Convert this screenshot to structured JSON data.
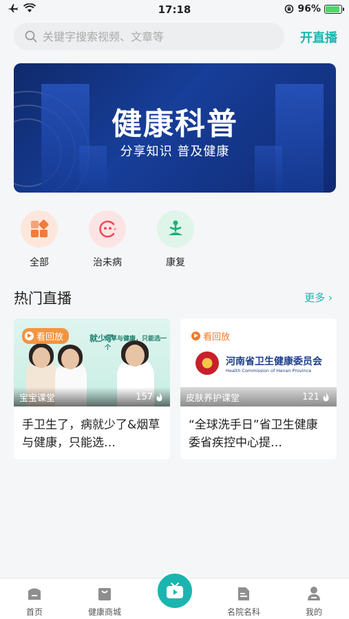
{
  "status_bar": {
    "time": "17:18",
    "battery": "96%",
    "battery_level": 0.96
  },
  "search": {
    "placeholder": "关键字搜索视频、文章等",
    "go_live_label": "开直播"
  },
  "banner": {
    "title": "健康科普",
    "subtitle": "分享知识 普及健康"
  },
  "categories": [
    {
      "label": "全部",
      "icon": "grid-icon",
      "bg": "#fde7dc",
      "color": "#f27b3c"
    },
    {
      "label": "治未病",
      "icon": "smile-icon",
      "bg": "#fde4e4",
      "color": "#ea4c5a"
    },
    {
      "label": "康复",
      "icon": "meditation-icon",
      "bg": "#dff5ea",
      "color": "#1fb07a"
    }
  ],
  "section": {
    "title": "热门直播",
    "more_label": "更多 ›"
  },
  "cards": [
    {
      "badge": "看回放",
      "channel": "宝宝课堂",
      "views": "157",
      "title": "手卫生了，病就少了&烟草与健康，只能选…",
      "thumb_text_1": "就少了",
      "thumb_text_2": "烟草与健康，只能选一个"
    },
    {
      "badge": "看回放",
      "channel": "皮肤养护课堂",
      "views": "121",
      "title": "“全球洗手日”省卫生健康委省疾控中心提…",
      "org_name": "河南省卫生健康委员会",
      "org_name_en": "Health Commission of Henan Province"
    }
  ],
  "tabbar": [
    {
      "label": "首页",
      "icon": "home-icon"
    },
    {
      "label": "健康商城",
      "icon": "shopping-bag-icon"
    },
    {
      "label": "",
      "icon": "live-tv-icon"
    },
    {
      "label": "名院名科",
      "icon": "hospital-icon"
    },
    {
      "label": "我的",
      "icon": "user-icon"
    }
  ],
  "colors": {
    "accent": "#1bb5b0",
    "replay": "#f07a2b",
    "banner": "#173e99"
  }
}
